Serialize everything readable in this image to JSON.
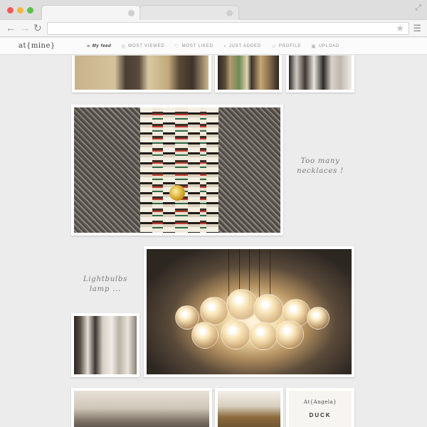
{
  "browser": {
    "tabs": [
      {
        "label": ""
      },
      {
        "label": ""
      }
    ],
    "address": "",
    "icons": [
      "back-arrow-icon",
      "forward-arrow-icon",
      "reload-icon",
      "star-icon",
      "hamburger-menu-icon",
      "resize-icon"
    ]
  },
  "site": {
    "logo": "at{mine}",
    "nav": [
      {
        "icon": "≡",
        "label": "My feed",
        "active": true
      },
      {
        "icon": "◎",
        "label": "MOST VIEWED",
        "active": false
      },
      {
        "icon": "♡",
        "label": "MOST LIKED",
        "active": false
      },
      {
        "icon": "+",
        "label": "JUST ADDED",
        "active": false
      },
      {
        "icon": "☺",
        "label": "PROFILE",
        "active": false
      },
      {
        "icon": "▣",
        "label": "UPLOAD",
        "active": false
      }
    ]
  },
  "feed": {
    "notes": [
      {
        "line1": "Too many",
        "line2": "necklaces !"
      },
      {
        "line1": "Lightbulbs",
        "line2": "lamp ..."
      }
    ],
    "book": {
      "title": "At{Angela}",
      "subtitle": "DUCK"
    }
  },
  "colors": {
    "accent_red": "#ee5c56",
    "accent_yellow": "#f3b73c",
    "accent_green": "#59c148",
    "background": "#ececec"
  }
}
